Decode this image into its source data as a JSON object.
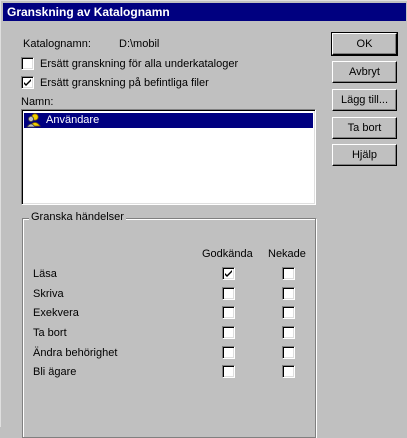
{
  "window": {
    "title": "Granskning av Katalognamn"
  },
  "directory": {
    "label": "Katalognamn:",
    "value": "D:\\mobil"
  },
  "options": {
    "replace_subdirs": {
      "label": "Ersätt granskning för alla underkataloger",
      "checked": false
    },
    "replace_files": {
      "label": "Ersätt granskning på befintliga filer",
      "checked": true
    }
  },
  "names": {
    "label": "Namn:",
    "items": [
      {
        "label": "Användare",
        "icon": "user-group-icon",
        "selected": true
      }
    ]
  },
  "buttons": {
    "ok": "OK",
    "cancel": "Avbryt",
    "add": "Lägg till...",
    "remove": "Ta bort",
    "help": "Hjälp"
  },
  "events": {
    "group_title": "Granska händelser",
    "col_success": "Godkända",
    "col_failure": "Nekade",
    "rows": [
      {
        "label": "Läsa",
        "success": true,
        "failure": false
      },
      {
        "label": "Skriva",
        "success": false,
        "failure": false
      },
      {
        "label": "Exekvera",
        "success": false,
        "failure": false
      },
      {
        "label": "Ta bort",
        "success": false,
        "failure": false
      },
      {
        "label": "Ändra behörighet",
        "success": false,
        "failure": false
      },
      {
        "label": "Bli ägare",
        "success": false,
        "failure": false
      }
    ]
  },
  "colors": {
    "title_bar": "#000080",
    "selection": "#000080",
    "face": "#c0c0c0"
  }
}
